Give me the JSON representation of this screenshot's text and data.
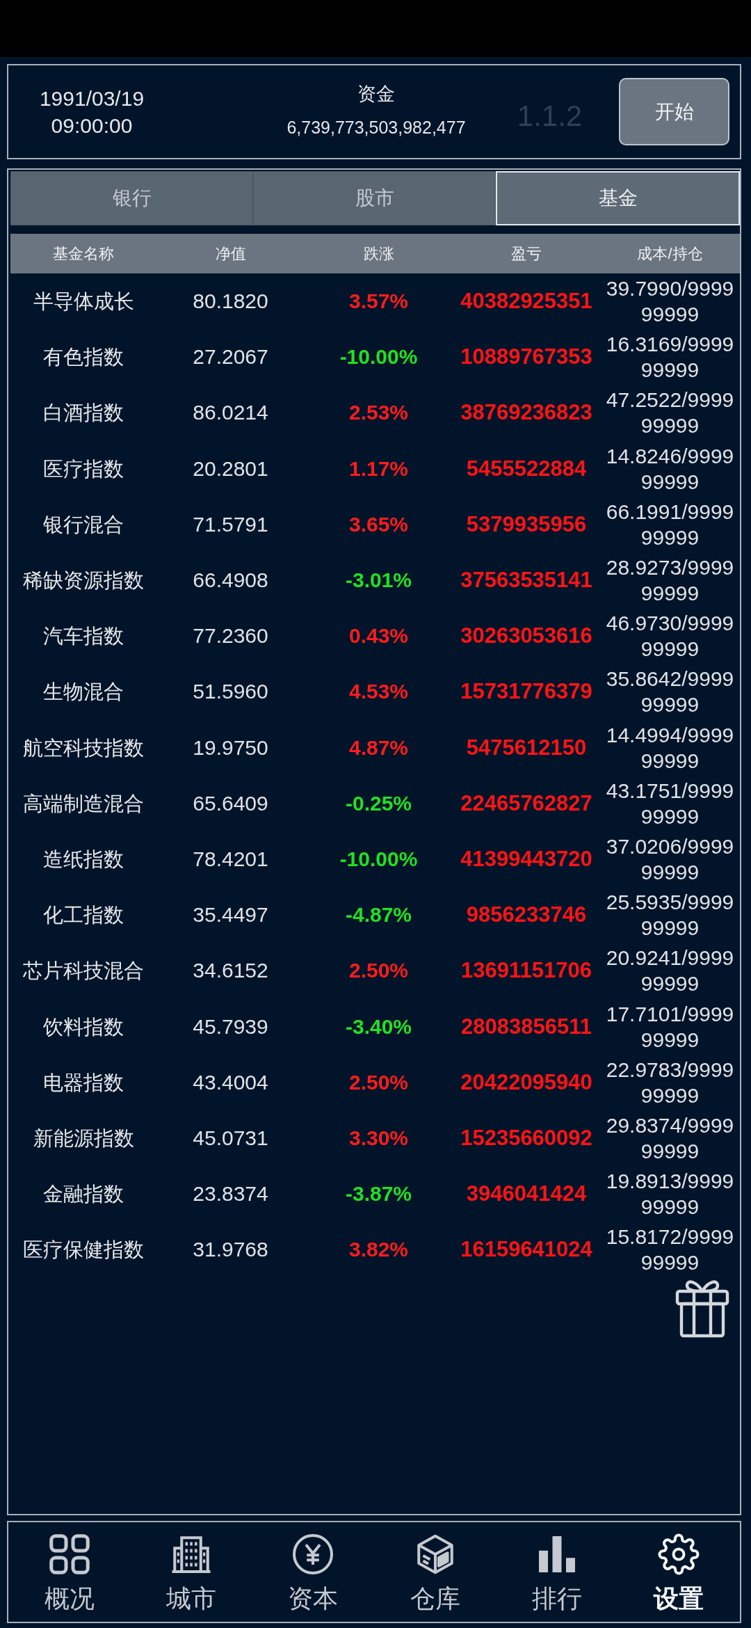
{
  "header": {
    "date": "1991/03/19",
    "time": "09:00:00",
    "funds_label": "资金",
    "funds_value": "6,739,773,503,982,477",
    "version": "1.1.2",
    "start_button": "开始"
  },
  "tabs": [
    {
      "label": "银行",
      "selected": false
    },
    {
      "label": "股市",
      "selected": false
    },
    {
      "label": "基金",
      "selected": true
    }
  ],
  "table": {
    "columns": [
      "基金名称",
      "净值",
      "跌涨",
      "盈亏",
      "成本/持仓"
    ],
    "rows": [
      {
        "name": "半导体成长",
        "net_value": "80.1820",
        "change": "3.57%",
        "rising": true,
        "profit": "40382925351",
        "cost_holding": "39.7990/999999999"
      },
      {
        "name": "有色指数",
        "net_value": "27.2067",
        "change": "-10.00%",
        "rising": false,
        "profit": "10889767353",
        "cost_holding": "16.3169/999999999"
      },
      {
        "name": "白酒指数",
        "net_value": "86.0214",
        "change": "2.53%",
        "rising": true,
        "profit": "38769236823",
        "cost_holding": "47.2522/999999999"
      },
      {
        "name": "医疗指数",
        "net_value": "20.2801",
        "change": "1.17%",
        "rising": true,
        "profit": "5455522884",
        "cost_holding": "14.8246/999999999"
      },
      {
        "name": "银行混合",
        "net_value": "71.5791",
        "change": "3.65%",
        "rising": true,
        "profit": "5379935956",
        "cost_holding": "66.1991/999999999"
      },
      {
        "name": "稀缺资源指数",
        "net_value": "66.4908",
        "change": "-3.01%",
        "rising": false,
        "profit": "37563535141",
        "cost_holding": "28.9273/999999999"
      },
      {
        "name": "汽车指数",
        "net_value": "77.2360",
        "change": "0.43%",
        "rising": true,
        "profit": "30263053616",
        "cost_holding": "46.9730/999999999"
      },
      {
        "name": "生物混合",
        "net_value": "51.5960",
        "change": "4.53%",
        "rising": true,
        "profit": "15731776379",
        "cost_holding": "35.8642/999999999"
      },
      {
        "name": "航空科技指数",
        "net_value": "19.9750",
        "change": "4.87%",
        "rising": true,
        "profit": "5475612150",
        "cost_holding": "14.4994/999999999"
      },
      {
        "name": "高端制造混合",
        "net_value": "65.6409",
        "change": "-0.25%",
        "rising": false,
        "profit": "22465762827",
        "cost_holding": "43.1751/999999999"
      },
      {
        "name": "造纸指数",
        "net_value": "78.4201",
        "change": "-10.00%",
        "rising": false,
        "profit": "41399443720",
        "cost_holding": "37.0206/999999999"
      },
      {
        "name": "化工指数",
        "net_value": "35.4497",
        "change": "-4.87%",
        "rising": false,
        "profit": "9856233746",
        "cost_holding": "25.5935/999999999"
      },
      {
        "name": "芯片科技混合",
        "net_value": "34.6152",
        "change": "2.50%",
        "rising": true,
        "profit": "13691151706",
        "cost_holding": "20.9241/999999999"
      },
      {
        "name": "饮料指数",
        "net_value": "45.7939",
        "change": "-3.40%",
        "rising": false,
        "profit": "28083856511",
        "cost_holding": "17.7101/999999999"
      },
      {
        "name": "电器指数",
        "net_value": "43.4004",
        "change": "2.50%",
        "rising": true,
        "profit": "20422095940",
        "cost_holding": "22.9783/999999999"
      },
      {
        "name": "新能源指数",
        "net_value": "45.0731",
        "change": "3.30%",
        "rising": true,
        "profit": "15235660092",
        "cost_holding": "29.8374/999999999"
      },
      {
        "name": "金融指数",
        "net_value": "23.8374",
        "change": "-3.87%",
        "rising": false,
        "profit": "3946041424",
        "cost_holding": "19.8913/999999999"
      },
      {
        "name": "医疗保健指数",
        "net_value": "31.9768",
        "change": "3.82%",
        "rising": true,
        "profit": "16159641024",
        "cost_holding": "15.8172/999999999"
      }
    ]
  },
  "nav": [
    {
      "label": "概况",
      "selected": false
    },
    {
      "label": "城市",
      "selected": false
    },
    {
      "label": "资本",
      "selected": false
    },
    {
      "label": "仓库",
      "selected": false
    },
    {
      "label": "排行",
      "selected": false
    },
    {
      "label": "设置",
      "selected": true
    }
  ]
}
